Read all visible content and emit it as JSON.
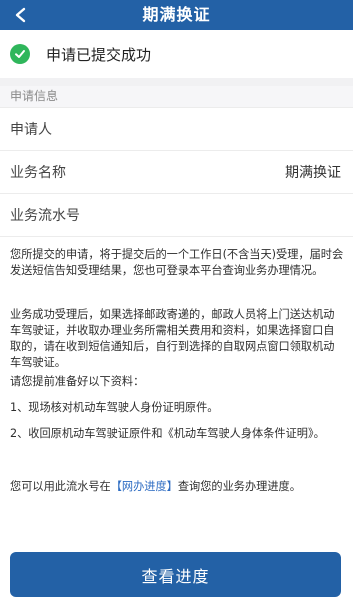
{
  "header": {
    "title": "期满换证"
  },
  "status": {
    "message": "申请已提交成功"
  },
  "section": {
    "label": "申请信息"
  },
  "fields": [
    {
      "label": "申请人",
      "value": ""
    },
    {
      "label": "业务名称",
      "value": "期满换证"
    },
    {
      "label": "业务流水号",
      "value": ""
    }
  ],
  "notes": {
    "p1": "您所提交的申请，将于提交后的一个工作日(不含当天)受理，届时会发送短信告知受理结果，您也可登录本平台查询业务办理情况。",
    "p2": "业务成功受理后，如果选择邮政寄递的，邮政人员将上门送达机动车驾驶证，并收取办理业务所需相关费用和资料，如果选择窗口自取的，请在收到短信通知后，自行到选择的自取网点窗口领取机动车驾驶证。",
    "p3": "请您提前准备好以下资料：",
    "p4": "1、现场核对机动车驾驶人身份证明原件。",
    "p5": "2、收回原机动车驾驶证原件和《机动车驾驶人身体条件证明》。",
    "p6_before": "您可以用此流水号在",
    "p6_link": "【网办进度】",
    "p6_after": "查询您的业务办理进度。"
  },
  "footer": {
    "button_label": "查看进度"
  },
  "colors": {
    "primary": "#2361a6",
    "success": "#2fb65b",
    "link": "#2c6bc2"
  }
}
